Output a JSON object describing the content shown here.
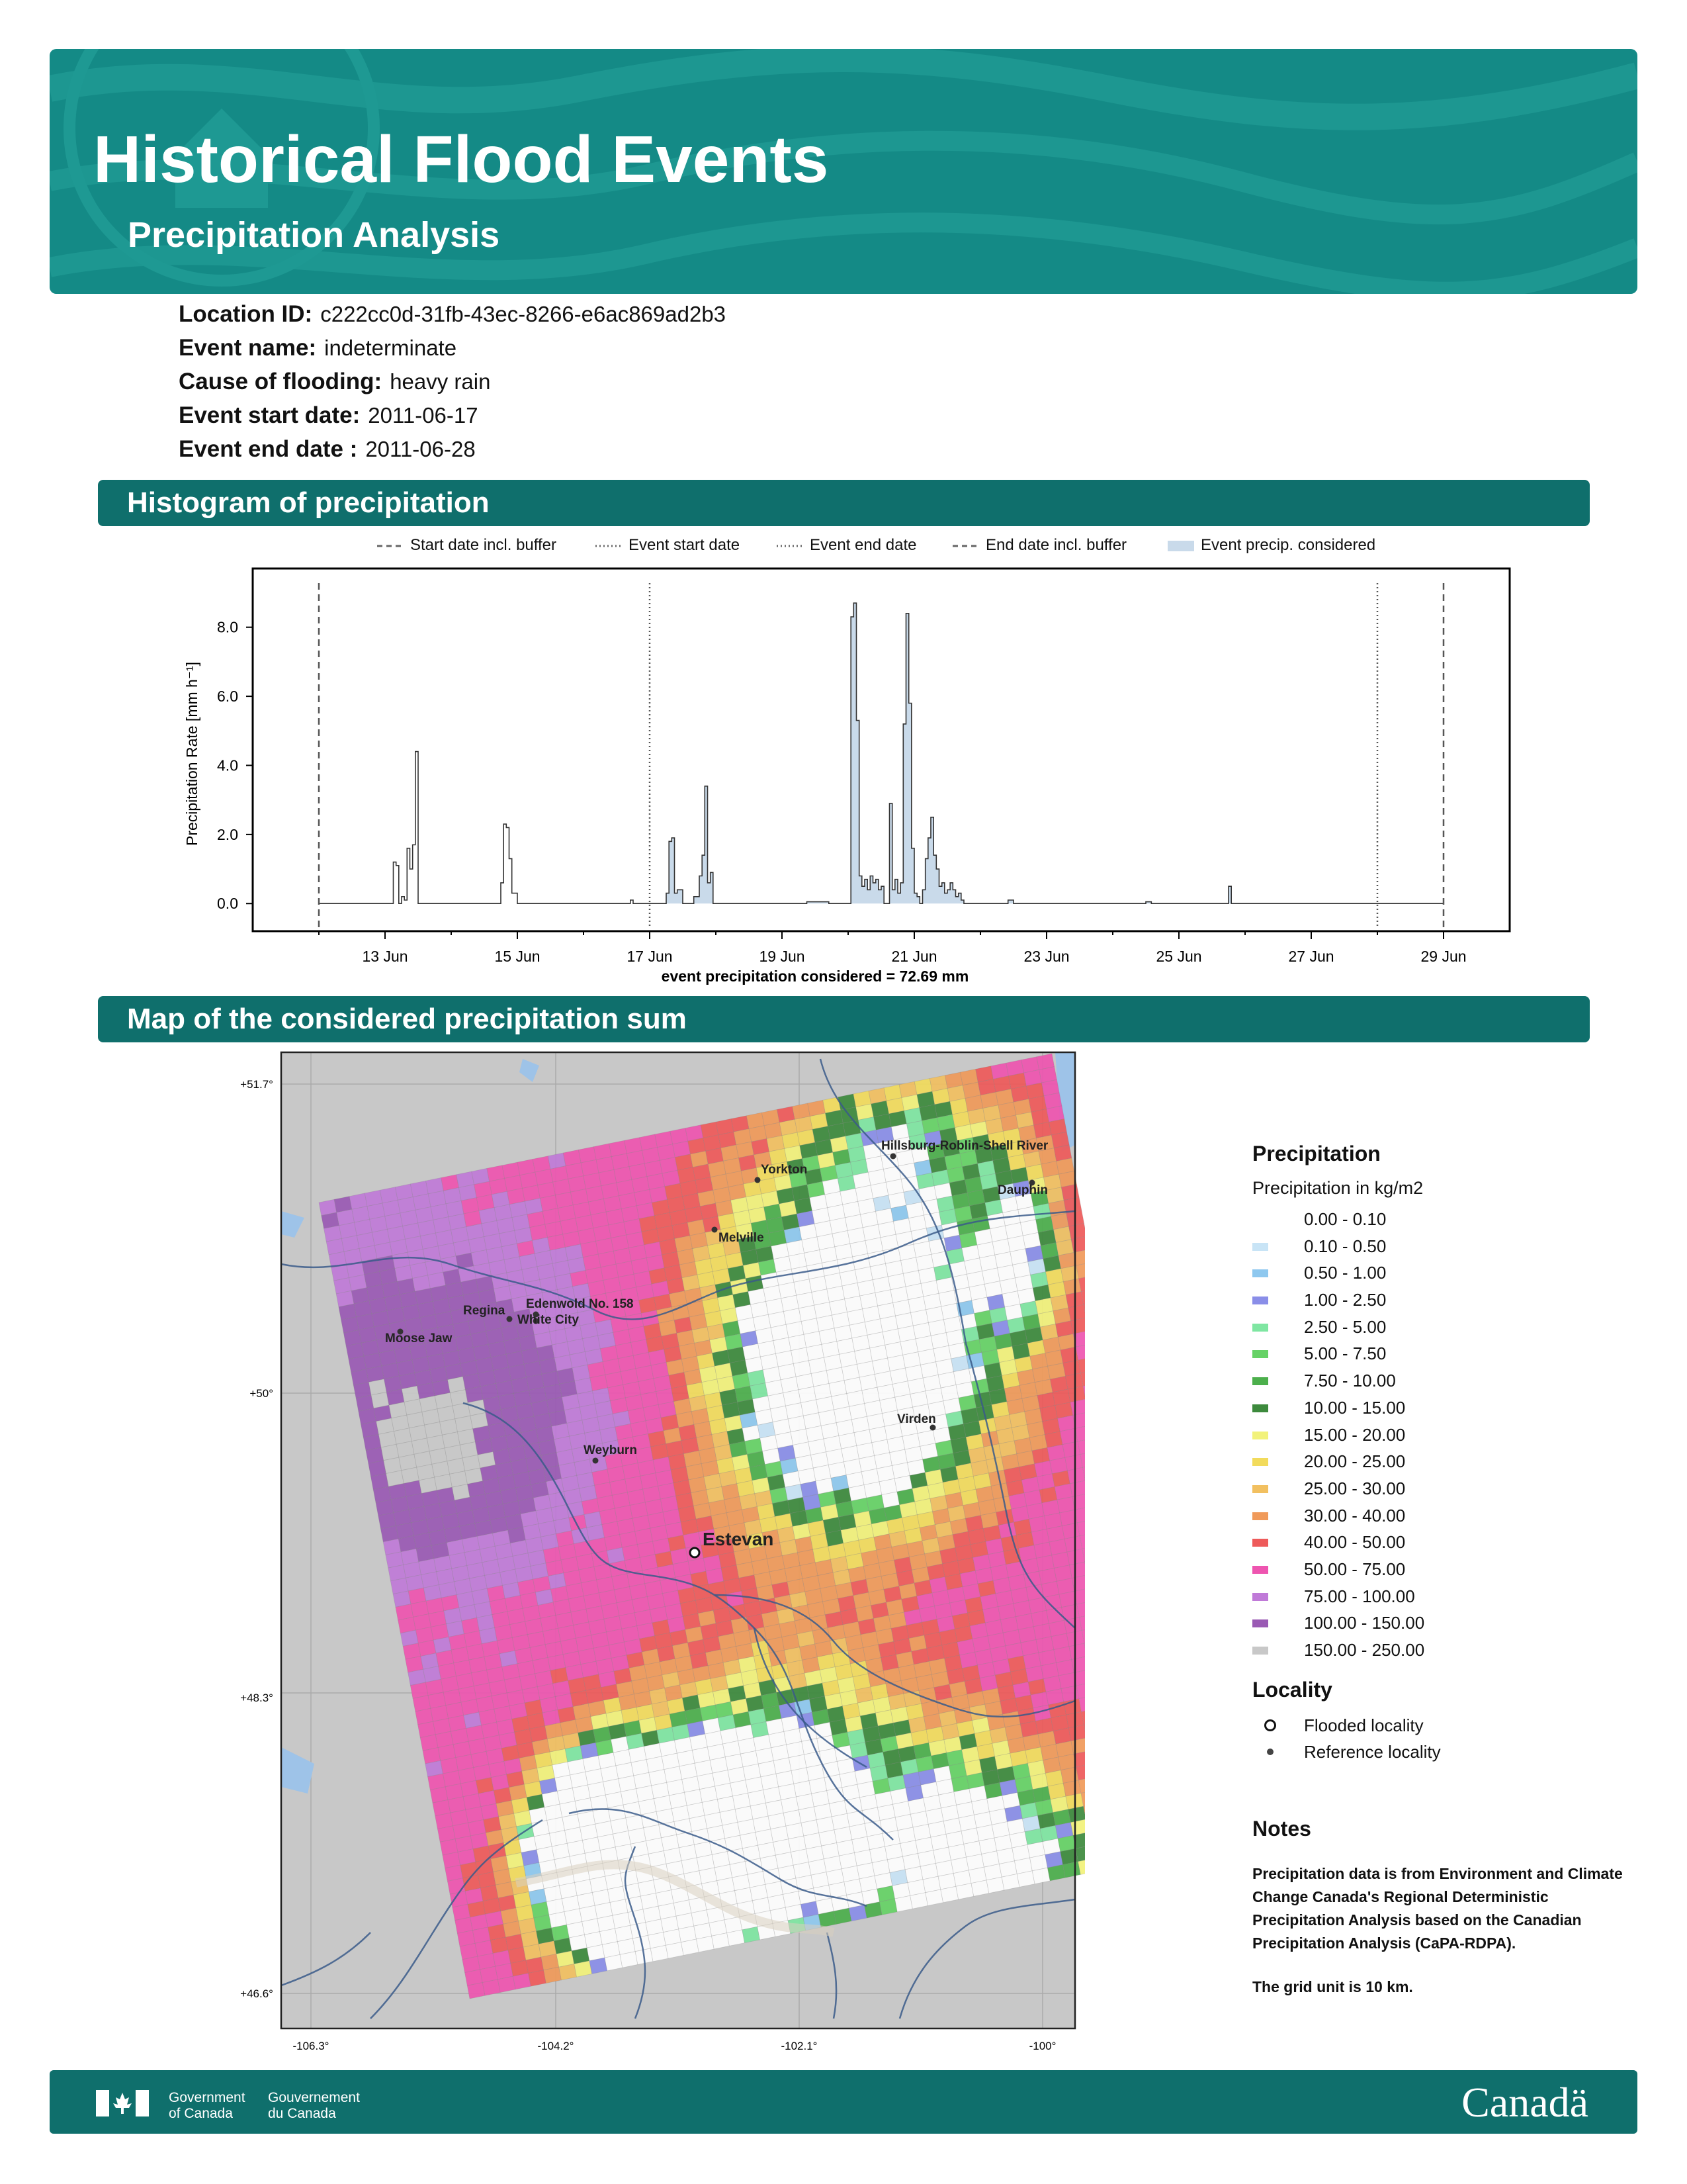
{
  "header": {
    "title": "Historical Flood Events",
    "subtitle": "Precipitation Analysis"
  },
  "info": [
    {
      "label": "Location ID:",
      "value": "c222cc0d-31fb-43ec-8266-e6ac869ad2b3"
    },
    {
      "label": "Event name:",
      "value": "indeterminate"
    },
    {
      "label": "Cause of flooding:",
      "value": "heavy rain"
    },
    {
      "label": "Event start date:",
      "value": "2011-06-17"
    },
    {
      "label": "Event end date :",
      "value": "2011-06-28"
    }
  ],
  "sections": {
    "histogram": "Histogram of precipitation",
    "map": "Map of the considered precipitation sum"
  },
  "chart_data": {
    "type": "area",
    "ylabel": "Precipitation Rate [mm h⁻¹]",
    "xlabel": "event precipitation considered = 72.69 mm",
    "ylim": [
      -0.8,
      9.7
    ],
    "xlim": [
      "2011-06-11",
      "2011-06-30"
    ],
    "yticks": [
      "0.0",
      "2.0",
      "4.0",
      "6.0",
      "8.0"
    ],
    "xticks": [
      "13 Jun",
      "15 Jun",
      "17 Jun",
      "19 Jun",
      "21 Jun",
      "23 Jun",
      "25 Jun",
      "27 Jun",
      "29 Jun"
    ],
    "legend": [
      {
        "label": "Start date incl. buffer",
        "style": "dashed"
      },
      {
        "label": "Event start date",
        "style": "dotted"
      },
      {
        "label": "Event end date",
        "style": "dotted"
      },
      {
        "label": "End date incl. buffer",
        "style": "dashed"
      },
      {
        "label": "Event precip. considered",
        "style": "fill"
      }
    ],
    "markers": {
      "start_buffer": "2011-06-12",
      "event_start": "2011-06-17",
      "event_end": "2011-06-28",
      "end_buffer": "2011-06-29"
    },
    "fill_color": "#c9daea",
    "series": [
      {
        "x": [
          "06-12 00:00",
          "06-13 02:00",
          "06-13 03:00",
          "06-13 04:00",
          "06-13 05:00",
          "06-13 06:00",
          "06-13 07:00",
          "06-13 08:00",
          "06-13 09:00",
          "06-13 10:00",
          "06-13 11:00",
          "06-13 12:00",
          "06-14 17:00",
          "06-14 18:00",
          "06-14 19:00",
          "06-14 20:00",
          "06-14 21:00",
          "06-14 22:00",
          "06-15 00:00",
          "06-16 17:00",
          "06-16 18:00",
          "06-17 00:00",
          "06-17 05:00",
          "06-17 06:00",
          "06-17 07:00",
          "06-17 08:00",
          "06-17 09:00",
          "06-17 10:00",
          "06-17 12:00",
          "06-17 16:00",
          "06-17 18:00",
          "06-17 19:00",
          "06-17 20:00",
          "06-17 21:00",
          "06-17 22:00",
          "06-17 23:00",
          "06-18 00:00",
          "06-18 02:00",
          "06-19 09:00",
          "06-19 17:00",
          "06-20 00:00",
          "06-20 01:00",
          "06-20 02:00",
          "06-20 03:00",
          "06-20 04:00",
          "06-20 05:00",
          "06-20 06:00",
          "06-20 07:00",
          "06-20 08:00",
          "06-20 09:00",
          "06-20 10:00",
          "06-20 11:00",
          "06-20 12:00",
          "06-20 13:00",
          "06-20 14:00",
          "06-20 15:00",
          "06-20 16:00",
          "06-20 17:00",
          "06-20 18:00",
          "06-20 19:00",
          "06-20 20:00",
          "06-20 21:00",
          "06-20 22:00",
          "06-20 23:00",
          "06-21 00:00",
          "06-21 01:00",
          "06-21 02:00",
          "06-21 03:00",
          "06-21 04:00",
          "06-21 05:00",
          "06-21 06:00",
          "06-21 07:00",
          "06-21 08:00",
          "06-21 09:00",
          "06-21 10:00",
          "06-21 11:00",
          "06-21 12:00",
          "06-21 13:00",
          "06-21 14:00",
          "06-21 15:00",
          "06-21 16:00",
          "06-21 17:00",
          "06-21 18:00",
          "06-21 20:00",
          "06-22 10:00",
          "06-22 12:00",
          "06-22 14:00",
          "06-24 12:00",
          "06-24 14:00",
          "06-25 18:00",
          "06-25 19:00",
          "06-25 20:00",
          "06-28 00:00",
          "06-29 00:00"
        ],
        "values": [
          0,
          0,
          1.2,
          1.1,
          0,
          0.2,
          0.1,
          1.6,
          1.0,
          1.7,
          4.4,
          0,
          0,
          0.6,
          2.3,
          2.2,
          1.3,
          0.3,
          0,
          0.1,
          0,
          0,
          0,
          0.3,
          1.8,
          1.9,
          0.3,
          0.4,
          0,
          0.2,
          0.8,
          1.4,
          3.4,
          0.6,
          0.9,
          0,
          0,
          0,
          0.05,
          0,
          0,
          8.3,
          8.7,
          5.3,
          0.8,
          0.5,
          0.7,
          0.4,
          0.8,
          0.6,
          0.7,
          0.4,
          0.5,
          0,
          0,
          2.9,
          0.4,
          0.7,
          0.3,
          0.6,
          5.2,
          8.4,
          5.8,
          1.6,
          0.3,
          0.2,
          0,
          0.4,
          1.3,
          1.9,
          2.5,
          1.4,
          1.0,
          0.5,
          0.6,
          0.3,
          0.4,
          0.6,
          0.4,
          0.2,
          0.3,
          0.1,
          0,
          0,
          0.1,
          0,
          0,
          0.05,
          0,
          0.5,
          0,
          0,
          0,
          0
        ]
      }
    ]
  },
  "map": {
    "lat_labels": [
      "+51.7°",
      "+50°",
      "+48.3°",
      "+46.6°"
    ],
    "lon_labels": [
      "-106.3°",
      "-104.2°",
      "-102.1°",
      "-100°"
    ],
    "places": [
      {
        "name": "Yorkton"
      },
      {
        "name": "Hillsburg-Roblin-Shell River"
      },
      {
        "name": "Dauphin"
      },
      {
        "name": "Melville"
      },
      {
        "name": "Edenwold No. 158"
      },
      {
        "name": "Regina"
      },
      {
        "name": "White City"
      },
      {
        "name": "Moose Jaw"
      },
      {
        "name": "Virden"
      },
      {
        "name": "Weyburn"
      },
      {
        "name": "Estevan"
      }
    ],
    "colors": {
      "land": "#c8c8c8",
      "water": "#9ec3e8",
      "river": "#3a5a8a"
    }
  },
  "map_legend": {
    "title": "Precipitation",
    "subtitle": "Precipitation in kg/m2",
    "bins": [
      {
        "label": "0.00 - 0.10",
        "color": "#ffffff"
      },
      {
        "label": "0.10 - 0.50",
        "color": "#c8e4f6"
      },
      {
        "label": "0.50 - 1.00",
        "color": "#8ec8ef"
      },
      {
        "label": "1.00 - 2.50",
        "color": "#8a8ee8"
      },
      {
        "label": "2.50 - 5.00",
        "color": "#7fe6a2"
      },
      {
        "label": "5.00 - 7.50",
        "color": "#66d266"
      },
      {
        "label": "7.50 - 10.00",
        "color": "#4caf4c"
      },
      {
        "label": "10.00 - 15.00",
        "color": "#3d8a3d"
      },
      {
        "label": "15.00 - 20.00",
        "color": "#f2f27a"
      },
      {
        "label": "20.00 - 25.00",
        "color": "#f2db5c"
      },
      {
        "label": "25.00 - 30.00",
        "color": "#f2c060"
      },
      {
        "label": "30.00 - 40.00",
        "color": "#f09a5a"
      },
      {
        "label": "40.00 - 50.00",
        "color": "#ee5a5a"
      },
      {
        "label": "50.00 - 75.00",
        "color": "#ee55b0"
      },
      {
        "label": "75.00 - 100.00",
        "color": "#c07ad8"
      },
      {
        "label": "100.00 - 150.00",
        "color": "#9a5ab4"
      },
      {
        "label": "150.00 - 250.00",
        "color": "#c8c8c8"
      }
    ],
    "locality_title": "Locality",
    "flooded": "Flooded locality",
    "reference": "Reference locality"
  },
  "notes": {
    "title": "Notes",
    "text": "Precipitation data is from Environment and Climate Change Canada's Regional Deterministic Precipitation Analysis based on the Canadian Precipitation Analysis (CaPA-RDPA).",
    "grid": "The grid unit is 10 km."
  },
  "footer": {
    "gov_en": "Government\nof Canada",
    "gov_fr": "Gouvernement\ndu Canada",
    "wordmark": "Canadä"
  }
}
